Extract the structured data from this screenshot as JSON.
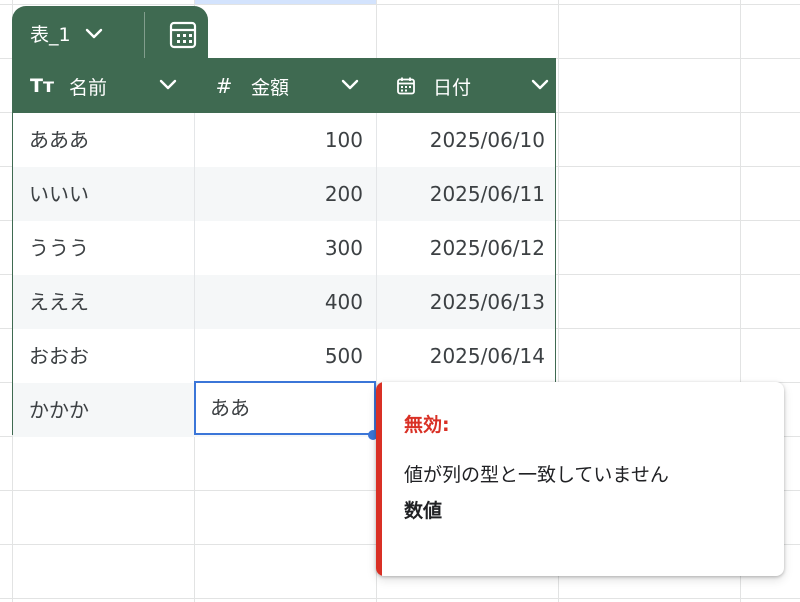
{
  "table": {
    "name": "表_1",
    "columns": [
      {
        "label": "名前",
        "type_icon": "text-type-icon",
        "type_glyph": "Tт"
      },
      {
        "label": "金額",
        "type_icon": "number-type-icon",
        "type_glyph": "#"
      },
      {
        "label": "日付",
        "type_icon": "calendar-icon",
        "type_glyph": ""
      }
    ],
    "rows": [
      {
        "name": "あああ",
        "amount": "100",
        "date": "2025/06/10"
      },
      {
        "name": "いいい",
        "amount": "200",
        "date": "2025/06/11"
      },
      {
        "name": "ううう",
        "amount": "300",
        "date": "2025/06/12"
      },
      {
        "name": "えええ",
        "amount": "400",
        "date": "2025/06/13"
      },
      {
        "name": "おおお",
        "amount": "500",
        "date": "2025/06/14"
      },
      {
        "name": "かかか",
        "amount": "ああ",
        "date": ""
      }
    ]
  },
  "validation": {
    "title": "無効:",
    "message": "値が列の型と一致していません",
    "expected_type": "数値"
  },
  "colors": {
    "table_header": "#3f6a51",
    "selection": "#3b76d8",
    "error": "#d93025"
  }
}
